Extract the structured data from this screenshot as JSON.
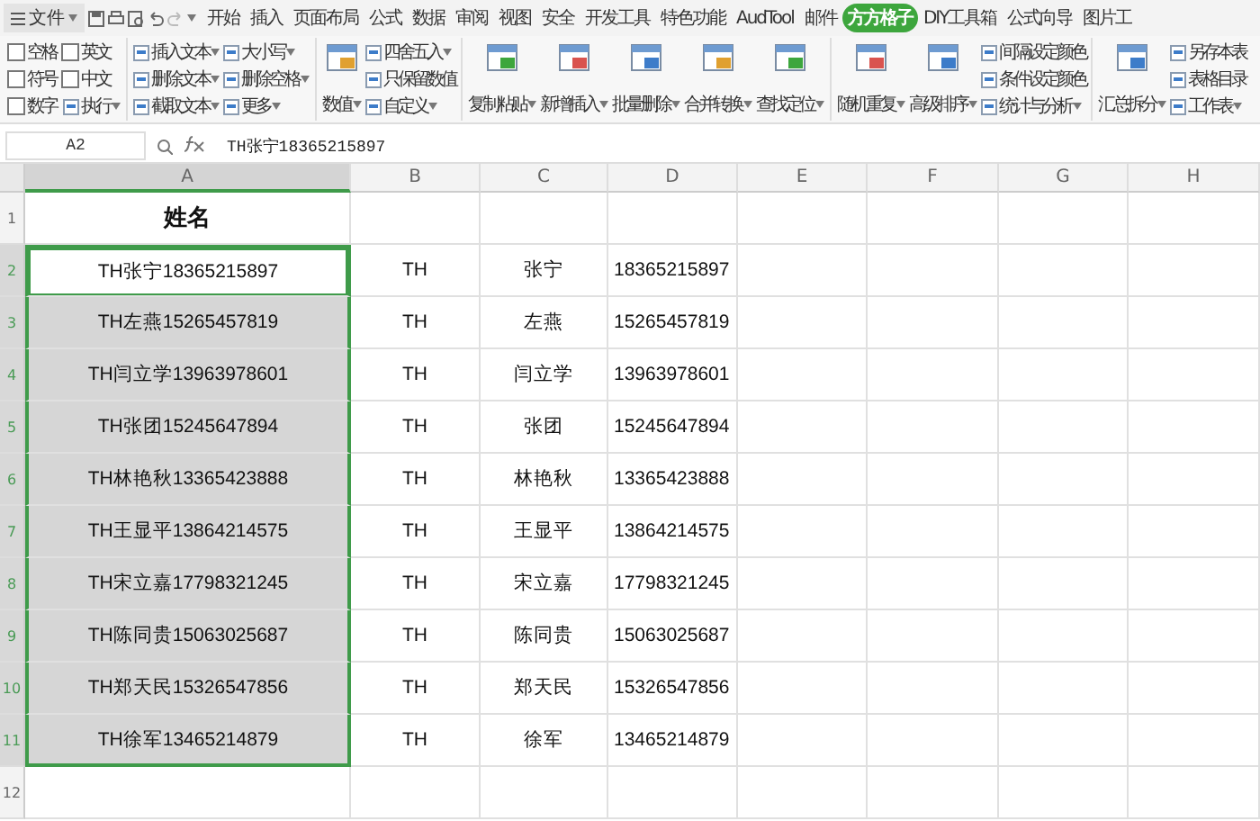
{
  "menu_button": {
    "label": "文件"
  },
  "tabs": [
    {
      "label": "开始",
      "selected": false
    },
    {
      "label": "插入",
      "selected": false
    },
    {
      "label": "页面布局",
      "selected": false
    },
    {
      "label": "公式",
      "selected": false
    },
    {
      "label": "数据",
      "selected": false
    },
    {
      "label": "审阅",
      "selected": false
    },
    {
      "label": "视图",
      "selected": false
    },
    {
      "label": "安全",
      "selected": false
    },
    {
      "label": "开发工具",
      "selected": false
    },
    {
      "label": "特色功能",
      "selected": false
    },
    {
      "label": "AudTool",
      "selected": false
    },
    {
      "label": "邮件",
      "selected": false
    },
    {
      "label": "方方格子",
      "selected": true
    },
    {
      "label": "DIY工具箱",
      "selected": false
    },
    {
      "label": "公式向导",
      "selected": false
    },
    {
      "label": "图片工",
      "selected": false
    }
  ],
  "ribbon": [
    {
      "blocks": [
        {
          "kind": "stack",
          "items": [
            {
              "kind": "check",
              "label": "空格",
              "checked": false
            },
            {
              "kind": "check",
              "label": "符号",
              "checked": false
            },
            {
              "kind": "check",
              "label": "数字",
              "checked": false
            }
          ]
        },
        {
          "kind": "stack",
          "items": [
            {
              "kind": "check",
              "label": "英文",
              "checked": false
            },
            {
              "kind": "check",
              "label": "中文",
              "checked": false
            },
            {
              "kind": "tool",
              "label": "执行",
              "dropdown": true
            }
          ]
        }
      ]
    },
    {
      "blocks": [
        {
          "kind": "stack",
          "items": [
            {
              "kind": "tool",
              "label": "插入文本",
              "dropdown": true
            },
            {
              "kind": "tool",
              "label": "删除文本",
              "dropdown": true
            },
            {
              "kind": "tool",
              "label": "截取文本",
              "dropdown": true
            }
          ]
        },
        {
          "kind": "stack",
          "items": [
            {
              "kind": "tool",
              "label": "大小写",
              "dropdown": true
            },
            {
              "kind": "tool",
              "label": "删除空格",
              "dropdown": true
            },
            {
              "kind": "tool",
              "label": "更多",
              "dropdown": true
            }
          ]
        }
      ]
    },
    {
      "blocks": [
        {
          "kind": "large",
          "label": "数值",
          "dropdown": true
        },
        {
          "kind": "stack",
          "items": [
            {
              "kind": "tool",
              "label": "四舍五入",
              "dropdown": true
            },
            {
              "kind": "tool",
              "label": "只保留数值",
              "dropdown": false
            },
            {
              "kind": "tool",
              "label": "自定义",
              "dropdown": true
            }
          ]
        }
      ]
    },
    {
      "blocks": [
        {
          "kind": "large",
          "label": "复制粘贴",
          "dropdown": true
        },
        {
          "kind": "large",
          "label": "新增插入",
          "dropdown": true
        },
        {
          "kind": "large",
          "label": "批量删除",
          "dropdown": true
        },
        {
          "kind": "large",
          "label": "合并转换",
          "dropdown": true
        },
        {
          "kind": "large",
          "label": "查找定位",
          "dropdown": true
        }
      ]
    },
    {
      "blocks": [
        {
          "kind": "large",
          "label": "随机重复",
          "dropdown": true
        },
        {
          "kind": "large",
          "label": "高级排序",
          "dropdown": true
        },
        {
          "kind": "stack",
          "items": [
            {
              "kind": "tool",
              "label": "间隔设定颜色",
              "dropdown": false
            },
            {
              "kind": "tool",
              "label": "条件设定颜色",
              "dropdown": false
            },
            {
              "kind": "tool",
              "label": "统计与分析",
              "dropdown": true
            }
          ]
        }
      ]
    },
    {
      "blocks": [
        {
          "kind": "large",
          "label": "汇总拆分",
          "dropdown": true
        },
        {
          "kind": "stack",
          "items": [
            {
              "kind": "tool",
              "label": "另存本表",
              "dropdown": false
            },
            {
              "kind": "tool",
              "label": "表格目录",
              "dropdown": false
            },
            {
              "kind": "tool",
              "label": "工作表",
              "dropdown": true
            }
          ]
        }
      ]
    }
  ],
  "name_box": "A2",
  "formula": "TH张宁18365215897",
  "columns": [
    {
      "label": "A",
      "selected": true
    },
    {
      "label": "B",
      "selected": false
    },
    {
      "label": "C",
      "selected": false
    },
    {
      "label": "D",
      "selected": false
    },
    {
      "label": "E",
      "selected": false
    },
    {
      "label": "F",
      "selected": false
    },
    {
      "label": "G",
      "selected": false
    },
    {
      "label": "H",
      "selected": false
    }
  ],
  "rows": [
    {
      "number": "1",
      "selected": false,
      "active": false,
      "cells": [
        "姓名",
        "",
        "",
        ""
      ]
    },
    {
      "number": "2",
      "selected": true,
      "active": true,
      "cells": [
        "TH张宁18365215897",
        "TH",
        "张宁",
        "18365215897"
      ]
    },
    {
      "number": "3",
      "selected": true,
      "active": false,
      "cells": [
        "TH左燕15265457819",
        "TH",
        "左燕",
        "15265457819"
      ]
    },
    {
      "number": "4",
      "selected": true,
      "active": false,
      "cells": [
        "TH闫立学13963978601",
        "TH",
        "闫立学",
        "13963978601"
      ]
    },
    {
      "number": "5",
      "selected": true,
      "active": false,
      "cells": [
        "TH张团15245647894",
        "TH",
        "张团",
        "15245647894"
      ]
    },
    {
      "number": "6",
      "selected": true,
      "active": false,
      "cells": [
        "TH林艳秋13365423888",
        "TH",
        "林艳秋",
        "13365423888"
      ]
    },
    {
      "number": "7",
      "selected": true,
      "active": false,
      "cells": [
        "TH王显平13864214575",
        "TH",
        "王显平",
        "13864214575"
      ]
    },
    {
      "number": "8",
      "selected": true,
      "active": false,
      "cells": [
        "TH宋立嘉17798321245",
        "TH",
        "宋立嘉",
        "17798321245"
      ]
    },
    {
      "number": "9",
      "selected": true,
      "active": false,
      "cells": [
        "TH陈同贵15063025687",
        "TH",
        "陈同贵",
        "15063025687"
      ]
    },
    {
      "number": "10",
      "selected": true,
      "active": false,
      "cells": [
        "TH郑天民15326547856",
        "TH",
        "郑天民",
        "15326547856"
      ]
    },
    {
      "number": "11",
      "selected": true,
      "active": false,
      "cells": [
        "TH徐军13465214879",
        "TH",
        "徐军",
        "13465214879"
      ]
    },
    {
      "number": "12",
      "selected": false,
      "active": false,
      "cells": [
        "",
        "",
        "",
        ""
      ]
    }
  ]
}
